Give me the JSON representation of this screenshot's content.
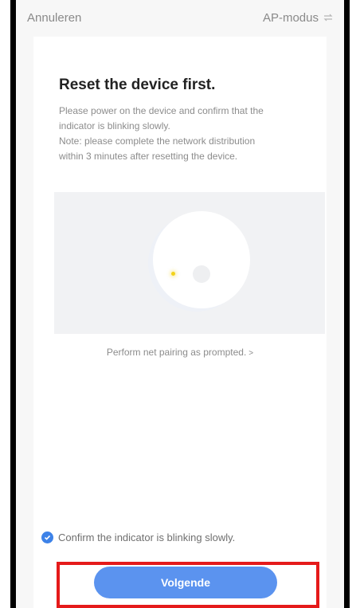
{
  "header": {
    "cancel_label": "Annuleren",
    "mode_label": "AP-modus",
    "mode_icon": "switch-arrows-icon"
  },
  "card": {
    "title": "Reset the device first.",
    "description_lines": [
      "Please power on the device and confirm that the",
      "indicator is blinking slowly.",
      "Note: please complete the network distribution",
      "within 3 minutes after resetting the device."
    ],
    "illustration": {
      "indicator_color": "#f2d21a"
    },
    "pairing_link": "Perform net pairing as prompted.",
    "pairing_link_icon": "chevron-right-icon"
  },
  "confirm": {
    "checked": true,
    "label": "Confirm the indicator is blinking slowly."
  },
  "footer": {
    "next_label": "Volgende",
    "highlight_color": "#e51a1a",
    "button_color": "#5b93ef"
  }
}
